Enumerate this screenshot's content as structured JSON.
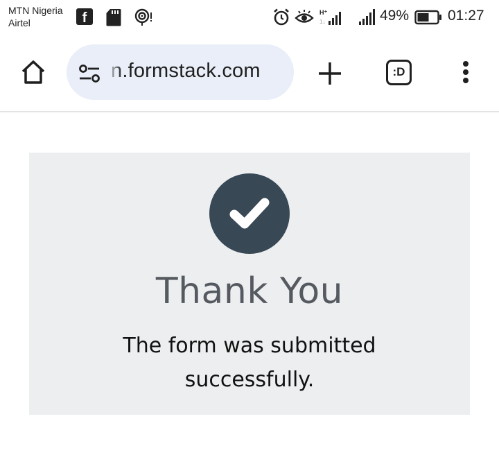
{
  "status_bar": {
    "carrier_line1": "MTN Nigeria",
    "carrier_line2": "Airtel",
    "battery_percent": "49%",
    "time": "01:27",
    "icons": [
      "facebook-icon",
      "sd-card-icon",
      "hotspot-icon",
      "alarm-icon",
      "eye-comfort-icon",
      "signal-icon",
      "signal-icon",
      "battery-icon"
    ]
  },
  "browser": {
    "url": "n.formstack.com",
    "tab_count_label": ":D",
    "icons": [
      "home-icon",
      "tune-icon",
      "plus-icon",
      "tab-switcher-icon",
      "more-vert-icon"
    ]
  },
  "page": {
    "title": "Thank You",
    "message": "The form was submitted successfully.",
    "icon": "checkmark-icon",
    "colors": {
      "card_bg": "#edeef0",
      "check_bg": "#384855",
      "title": "#555a60"
    }
  }
}
